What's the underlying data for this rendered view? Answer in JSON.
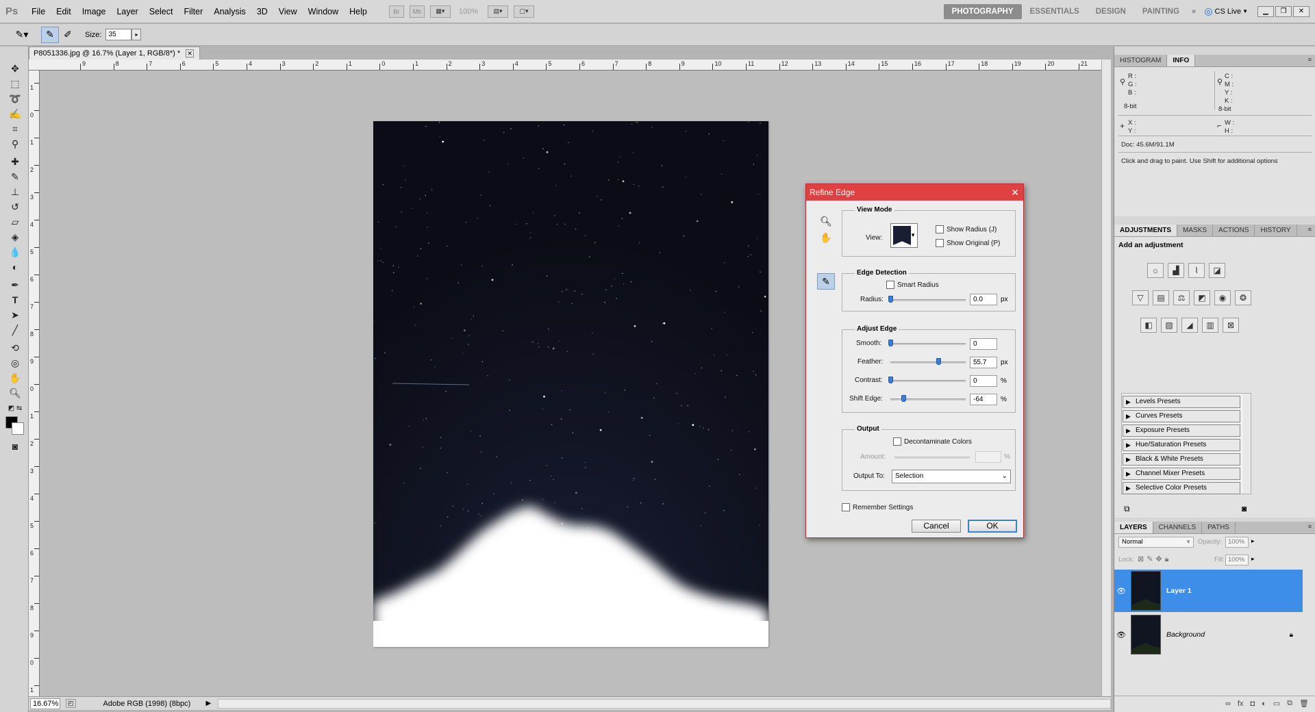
{
  "app": {
    "logo": "Ps"
  },
  "menu": [
    "File",
    "Edit",
    "Image",
    "Layer",
    "Select",
    "Filter",
    "Analysis",
    "3D",
    "View",
    "Window",
    "Help"
  ],
  "appbar": {
    "br_label": "Br",
    "mb_label": "Mb",
    "zoom_level": "100%"
  },
  "workspaces": [
    "PHOTOGRAPHY",
    "ESSENTIALS",
    "DESIGN",
    "PAINTING"
  ],
  "workspace_more": "»",
  "cslive": "CS Live",
  "options": {
    "size_label": "Size:",
    "size_value": "35"
  },
  "document": {
    "tab_title": "P8051336.jpg @ 16.7% (Layer 1, RGB/8*) *",
    "zoom": "16.67%",
    "profile": "Adobe RGB (1998) (8bpc)",
    "ruler_top": [
      "9",
      "8",
      "7",
      "6",
      "5",
      "4",
      "3",
      "2",
      "1",
      "0",
      "1",
      "2",
      "3",
      "4",
      "5",
      "6",
      "7",
      "8",
      "9",
      "10",
      "11",
      "12",
      "13",
      "14",
      "15",
      "16",
      "17",
      "18",
      "19",
      "20",
      "21"
    ],
    "ruler_left": [
      "1",
      "0",
      "1",
      "2",
      "3",
      "4",
      "5",
      "6",
      "7",
      "8",
      "9",
      "0",
      "1",
      "2",
      "3",
      "4",
      "5",
      "6",
      "7",
      "8",
      "9",
      "0",
      "1"
    ]
  },
  "info_panel": {
    "tabs": [
      "HISTOGRAM",
      "INFO"
    ],
    "left_rgb": [
      "R :",
      "G :",
      "B :"
    ],
    "right_cmyk": [
      "C :",
      "M :",
      "Y :",
      "K :"
    ],
    "bit_left": "8-bit",
    "bit_right": "8-bit",
    "xy": [
      "X :",
      "Y :"
    ],
    "wh": [
      "W :",
      "H :"
    ],
    "doc": "Doc: 45.6M/91.1M",
    "hint": "Click and drag to paint.  Use Shift for additional options"
  },
  "adjustments_panel": {
    "tabs": [
      "ADJUSTMENTS",
      "MASKS",
      "ACTIONS",
      "HISTORY"
    ],
    "heading": "Add an adjustment",
    "presets": [
      "Levels Presets",
      "Curves Presets",
      "Exposure Presets",
      "Hue/Saturation Presets",
      "Black & White Presets",
      "Channel Mixer Presets",
      "Selective Color Presets"
    ]
  },
  "layers_panel": {
    "tabs": [
      "LAYERS",
      "CHANNELS",
      "PATHS"
    ],
    "blend_mode": "Normal",
    "opacity_label": "Opacity:",
    "opacity_value": "100%",
    "lock_label": "Lock:",
    "fill_label": "Fill:",
    "fill_value": "100%",
    "layers": [
      {
        "name": "Layer 1",
        "selected": true
      },
      {
        "name": "Background",
        "selected": false
      }
    ]
  },
  "refine_edge": {
    "title": "Refine Edge",
    "view_mode": {
      "title": "View Mode",
      "view_label": "View:",
      "show_radius": "Show Radius (J)",
      "show_original": "Show Original (P)"
    },
    "edge_detection": {
      "title": "Edge Detection",
      "smart_radius": "Smart Radius",
      "radius_label": "Radius:",
      "radius_value": "0.0",
      "radius_unit": "px"
    },
    "adjust_edge": {
      "title": "Adjust Edge",
      "smooth_label": "Smooth:",
      "smooth_value": "0",
      "feather_label": "Feather:",
      "feather_value": "55.7",
      "feather_unit": "px",
      "contrast_label": "Contrast:",
      "contrast_value": "0",
      "contrast_unit": "%",
      "shift_label": "Shift Edge:",
      "shift_value": "-64",
      "shift_unit": "%"
    },
    "output": {
      "title": "Output",
      "decontaminate": "Decontaminate Colors",
      "amount_label": "Amount:",
      "amount_unit": "%",
      "output_to_label": "Output To:",
      "output_to_value": "Selection"
    },
    "remember": "Remember Settings",
    "cancel": "Cancel",
    "ok": "OK"
  },
  "colors": {
    "dialog_title_bar": "#e04040",
    "layer_selected": "#3d8ee8",
    "slider_thumb": "#3a7fd5",
    "night_sky": "#0e0f1a"
  }
}
